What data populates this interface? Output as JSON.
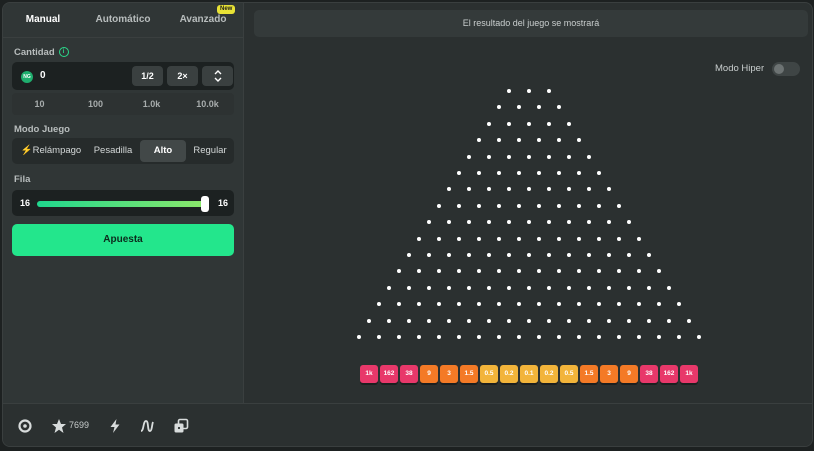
{
  "tabs": [
    "Manual",
    "Automático",
    "Avanzado"
  ],
  "new_badge": "New",
  "amount": {
    "label": "Cantidad",
    "coin": "NG",
    "value": "0",
    "half": "1/2",
    "double": "2×"
  },
  "chips": [
    "10",
    "100",
    "1.0k",
    "10.0k"
  ],
  "mode": {
    "label": "Modo Juego",
    "options": [
      "Relámpago",
      "Pesadilla",
      "Alto",
      "Regular"
    ],
    "selected": "Alto"
  },
  "rows": {
    "label": "Fila",
    "min": "16",
    "max": "16",
    "value": 16
  },
  "bet_button": "Apuesta",
  "result_text": "El resultado del juego se mostrará",
  "hiper": {
    "label": "Modo Hiper",
    "on": false
  },
  "footer": {
    "star_count": "7699"
  },
  "multipliers": [
    "1k",
    "162",
    "38",
    "9",
    "3",
    "1.5",
    "0.5",
    "0.2",
    "0.1",
    "0.2",
    "0.5",
    "1.5",
    "3",
    "9",
    "38",
    "162",
    "1k"
  ],
  "colors": {
    "accent": "#23e68c",
    "red": "#e8386a",
    "orange": "#f47a26",
    "yellow": "#f2b43a"
  }
}
